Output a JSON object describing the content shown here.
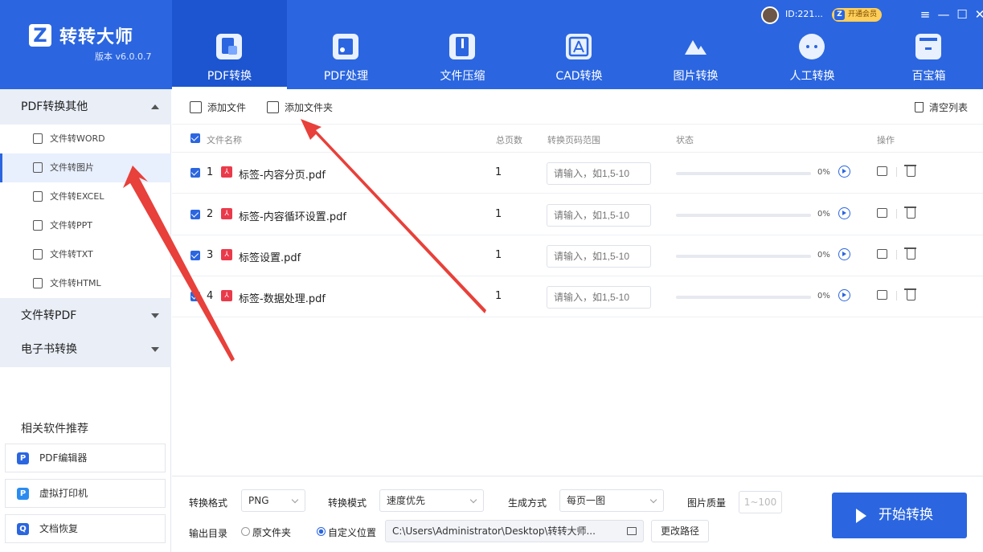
{
  "app": {
    "name": "转转大师",
    "version": "版本 v6.0.0.7",
    "logo_letter": "Z"
  },
  "account": {
    "id": "ID:221...",
    "vip_label": "开通会员"
  },
  "window_controls": [
    "≡",
    "—",
    "☐",
    "✕"
  ],
  "nav": [
    {
      "label": "PDF转换",
      "icon": "pdf-convert-icon",
      "active": true
    },
    {
      "label": "PDF处理",
      "icon": "pdf-process-icon",
      "active": false
    },
    {
      "label": "文件压缩",
      "icon": "zip-icon",
      "active": false
    },
    {
      "label": "CAD转换",
      "icon": "cad-icon",
      "active": false
    },
    {
      "label": "图片转换",
      "icon": "image-icon",
      "active": false
    },
    {
      "label": "人工转换",
      "icon": "chat-icon",
      "active": false
    },
    {
      "label": "百宝箱",
      "icon": "toolbox-icon",
      "active": false
    }
  ],
  "sidebar": {
    "groups": [
      {
        "label": "PDF转换其他",
        "expanded": true
      },
      {
        "label": "文件转PDF",
        "expanded": false
      },
      {
        "label": "电子书转换",
        "expanded": false
      }
    ],
    "items": [
      {
        "label": "文件转WORD",
        "icon": "word-file-icon",
        "active": false
      },
      {
        "label": "文件转图片",
        "icon": "image-file-icon",
        "active": true
      },
      {
        "label": "文件转EXCEL",
        "icon": "excel-file-icon",
        "active": false
      },
      {
        "label": "文件转PPT",
        "icon": "ppt-file-icon",
        "active": false
      },
      {
        "label": "文件转TXT",
        "icon": "txt-file-icon",
        "active": false
      },
      {
        "label": "文件转HTML",
        "icon": "html-file-icon",
        "active": false
      }
    ],
    "recommend_title": "相关软件推荐",
    "recommend": [
      {
        "label": "PDF编辑器",
        "icon": "pdf-editor-icon",
        "color": "#2b66e0",
        "glyph": "P"
      },
      {
        "label": "虚拟打印机",
        "icon": "printer-icon",
        "color": "#2b8cf0",
        "glyph": "P"
      },
      {
        "label": "文档恢复",
        "icon": "recovery-icon",
        "color": "#2b66e0",
        "glyph": "Q"
      }
    ]
  },
  "toolbar": {
    "add_file": "添加文件",
    "add_folder": "添加文件夹",
    "clear": "清空列表"
  },
  "table": {
    "headers": {
      "name": "文件名称",
      "pages": "总页数",
      "range": "转换页码范围",
      "status": "状态",
      "ops": "操作"
    },
    "rows": [
      {
        "index": "1",
        "name": "标签-内容分页.pdf",
        "pages": "1",
        "range_placeholder": "请输入，如1,5-10",
        "progress": 0,
        "percent": "0%"
      },
      {
        "index": "2",
        "name": "标签-内容循环设置.pdf",
        "pages": "1",
        "range_placeholder": "请输入，如1,5-10",
        "progress": 0,
        "percent": "0%"
      },
      {
        "index": "3",
        "name": "标签设置.pdf",
        "pages": "1",
        "range_placeholder": "请输入，如1,5-10",
        "progress": 0,
        "percent": "0%"
      },
      {
        "index": "4",
        "name": "标签-数据处理.pdf",
        "pages": "1",
        "range_placeholder": "请输入，如1,5-10",
        "progress": 0,
        "percent": "0%"
      }
    ]
  },
  "bottom": {
    "format_label": "转换格式",
    "format_value": "PNG",
    "mode_label": "转换模式",
    "mode_value": "速度优先",
    "gen_label": "生成方式",
    "gen_value": "每页一图",
    "quality_label": "图片质量",
    "quality_placeholder": "1~100",
    "output_label": "输出目录",
    "opt_source": "原文件夹",
    "opt_custom": "自定义位置",
    "path": "C:\\Users\\Administrator\\Desktop\\转转大师...",
    "change_path": "更改路径",
    "start": "开始转换"
  },
  "colors": {
    "primary": "#2b66e0",
    "annotation": "#e8403a"
  }
}
